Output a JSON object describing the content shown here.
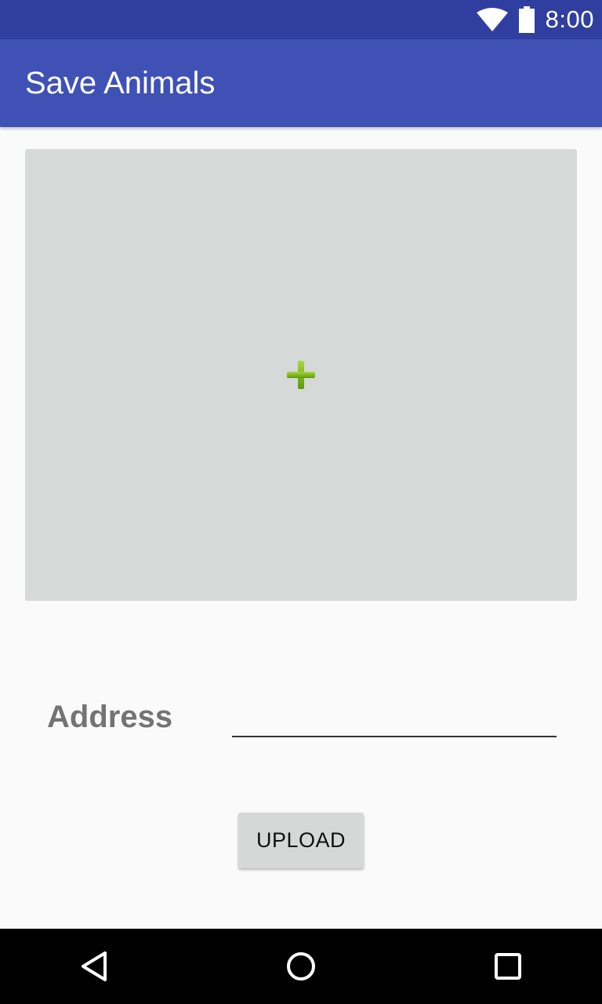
{
  "status_bar": {
    "time": "8:00",
    "icons": [
      "wifi-icon",
      "battery-icon"
    ],
    "background": "#303f9f"
  },
  "app_bar": {
    "title": "Save Animals",
    "background": "#3f51b5"
  },
  "image_picker": {
    "icon": "plus-icon",
    "icon_color": "#7cb518",
    "background": "#d7d9d8"
  },
  "address": {
    "label": "Address",
    "value": "",
    "placeholder": ""
  },
  "upload": {
    "label": "UPLOAD"
  },
  "nav_bar": {
    "icons": [
      "back-icon",
      "home-icon",
      "recents-icon"
    ]
  }
}
